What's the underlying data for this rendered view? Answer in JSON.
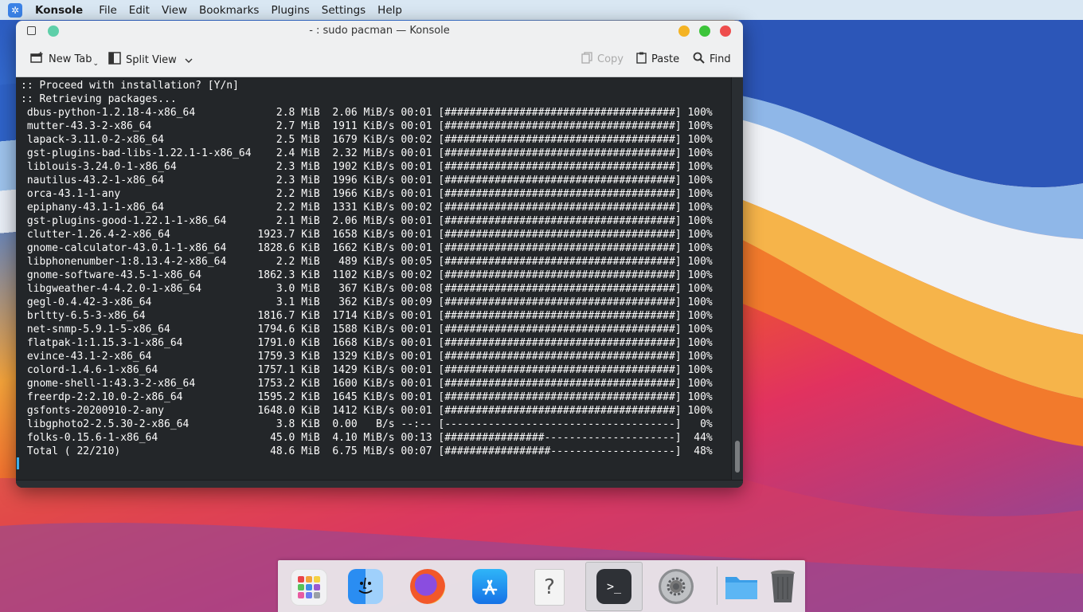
{
  "menubar": {
    "app": "Konsole",
    "items": [
      "File",
      "Edit",
      "View",
      "Bookmarks",
      "Plugins",
      "Settings",
      "Help"
    ]
  },
  "window": {
    "title": "- : sudo pacman — Konsole",
    "colors": {
      "pin": "#5ecfa9",
      "minimize": "#f4b324",
      "maximize": "#3cc43a",
      "close": "#ee4d4d"
    }
  },
  "toolbar": {
    "new_tab": "New Tab",
    "split_view": "Split View",
    "copy": "Copy",
    "paste": "Paste",
    "find": "Find"
  },
  "terminal": {
    "lines": [
      ":: Proceed with installation? [Y/n]",
      ":: Retrieving packages...",
      " dbus-python-1.2.18-4-x86_64             2.8 MiB  2.06 MiB/s 00:01 [#####################################] 100%",
      " mutter-43.3-2-x86_64                    2.7 MiB  1911 KiB/s 00:01 [#####################################] 100%",
      " lapack-3.11.0-2-x86_64                  2.5 MiB  1679 KiB/s 00:02 [#####################################] 100%",
      " gst-plugins-bad-libs-1.22.1-1-x86_64    2.4 MiB  2.32 MiB/s 00:01 [#####################################] 100%",
      " liblouis-3.24.0-1-x86_64                2.3 MiB  1902 KiB/s 00:01 [#####################################] 100%",
      " nautilus-43.2-1-x86_64                  2.3 MiB  1996 KiB/s 00:01 [#####################################] 100%",
      " orca-43.1-1-any                         2.2 MiB  1966 KiB/s 00:01 [#####################################] 100%",
      " epiphany-43.1-1-x86_64                  2.2 MiB  1331 KiB/s 00:02 [#####################################] 100%",
      " gst-plugins-good-1.22.1-1-x86_64        2.1 MiB  2.06 MiB/s 00:01 [#####################################] 100%",
      " clutter-1.26.4-2-x86_64              1923.7 KiB  1658 KiB/s 00:01 [#####################################] 100%",
      " gnome-calculator-43.0.1-1-x86_64     1828.6 KiB  1662 KiB/s 00:01 [#####################################] 100%",
      " libphonenumber-1:8.13.4-2-x86_64        2.2 MiB   489 KiB/s 00:05 [#####################################] 100%",
      " gnome-software-43.5-1-x86_64         1862.3 KiB  1102 KiB/s 00:02 [#####################################] 100%",
      " libgweather-4-4.2.0-1-x86_64            3.0 MiB   367 KiB/s 00:08 [#####################################] 100%",
      " gegl-0.4.42-3-x86_64                    3.1 MiB   362 KiB/s 00:09 [#####################################] 100%",
      " brltty-6.5-3-x86_64                  1816.7 KiB  1714 KiB/s 00:01 [#####################################] 100%",
      " net-snmp-5.9.1-5-x86_64              1794.6 KiB  1588 KiB/s 00:01 [#####################################] 100%",
      " flatpak-1:1.15.3-1-x86_64            1791.0 KiB  1668 KiB/s 00:01 [#####################################] 100%",
      " evince-43.1-2-x86_64                 1759.3 KiB  1329 KiB/s 00:01 [#####################################] 100%",
      " colord-1.4.6-1-x86_64                1757.1 KiB  1429 KiB/s 00:01 [#####################################] 100%",
      " gnome-shell-1:43.3-2-x86_64          1753.2 KiB  1600 KiB/s 00:01 [#####################################] 100%",
      " freerdp-2:2.10.0-2-x86_64            1595.2 KiB  1645 KiB/s 00:01 [#####################################] 100%",
      " gsfonts-20200910-2-any               1648.0 KiB  1412 KiB/s 00:01 [#####################################] 100%",
      " libgphoto2-2.5.30-2-x86_64              3.8 KiB  0.00   B/s --:-- [-------------------------------------]   0%",
      " folks-0.15.6-1-x86_64                  45.0 MiB  4.10 MiB/s 00:13 [################---------------------]  44%",
      " Total ( 22/210)                        48.6 MiB  6.75 MiB/s 00:07 [#################--------------------]  48%"
    ]
  },
  "dock": {
    "items": [
      {
        "name": "launchpad-icon"
      },
      {
        "name": "finder-icon"
      },
      {
        "name": "firefox-icon"
      },
      {
        "name": "app-store-icon"
      },
      {
        "name": "help-icon",
        "glyph": "?"
      },
      {
        "name": "terminal-icon",
        "glyph": ">_"
      },
      {
        "name": "settings-icon"
      },
      {
        "name": "folder-icon"
      },
      {
        "name": "trash-icon"
      }
    ]
  }
}
